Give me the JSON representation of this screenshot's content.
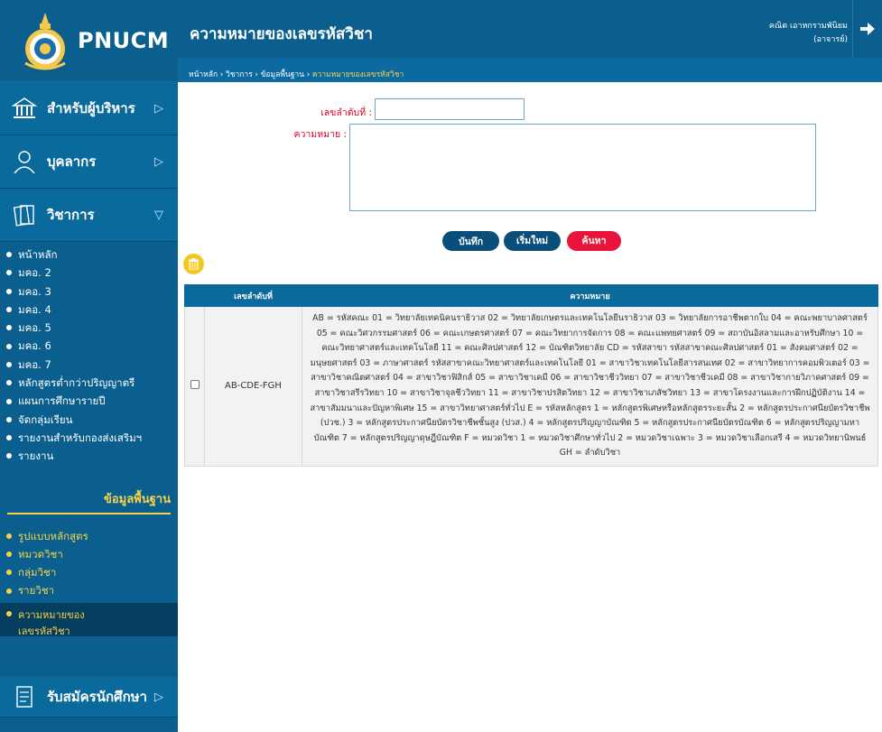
{
  "app": {
    "logo_text": "PNUCM"
  },
  "header": {
    "title": "ความหมายของเลขรหัสวิชา",
    "user_name": "คณิต เอาหกรามพันิยม",
    "user_role": "(อาจารย์)"
  },
  "breadcrumb": {
    "items": [
      "หน้าหลัก",
      "วิชาการ",
      "ข้อมูลพื้นฐาน"
    ],
    "separator": "›",
    "current": "ความหมายของเลขรหัสวิชา"
  },
  "sidebar": {
    "sections": [
      {
        "label": "สำหรับผู้บริหาร",
        "arrow": "▷"
      },
      {
        "label": "บุคลากร",
        "arrow": "▷"
      },
      {
        "label": "วิชาการ",
        "arrow": "▽"
      }
    ],
    "academic_items": [
      "หน้าหลัก",
      "มคอ. 2",
      "มคอ. 3",
      "มคอ. 4",
      "มคอ. 5",
      "มคอ. 6",
      "มคอ. 7",
      "หลักสูตรต่ำกว่าปริญญาตรี",
      "แผนการศึกษารายปี",
      "จัดกลุ่มเรียน",
      "รายงานสำหรับกองส่งเสริมฯ",
      "รายงาน"
    ],
    "data_title": "ข้อมูลพื้นฐาน",
    "data_items": [
      "รูปแบบหลักสูตร",
      "หมวดวิชา",
      "กลุ่มวิชา",
      "รายวิชา"
    ],
    "active_item_line1": "ความหมายของ",
    "active_item_line2": "เลขรหัสวิชา",
    "register_label": "รับสมัครนักศึกษา",
    "register_arrow": "▷"
  },
  "form": {
    "id_label": "เลขลำดับที่ :",
    "id_value": "",
    "meaning_label": "ความหมาย :",
    "meaning_value": "",
    "save_label": "บันทึก",
    "reset_label": "เริ่มใหม่",
    "search_label": "ค้นหา"
  },
  "table": {
    "columns": [
      "",
      "เลขลำดับที่",
      "ความหมาย"
    ],
    "rows": [
      {
        "code": "AB-CDE-FGH",
        "meaning": "AB = รหัสคณะ 01 = วิทยาลัยเทคนิคนราธิวาส 02 = วิทยาลัยเกษตรและเทคโนโลยีนราธิวาส 03 = วิทยาลัยการอาชีพตากใบ 04 = คณะพยาบาลศาสตร์ 05 = คณะวิศวกรรมศาสตร์ 06 = คณะเกษตรศาสตร์ 07 = คณะวิทยาการจัดการ 08 = คณะแพทยศาสตร์ 09 = สถาบันอิสลามและอาหรับศึกษา 10 = คณะวิทยาศาสตร์และเทคโนโลยี 11 = คณะศิลปศาสตร์ 12 = บัณฑิตวิทยาลัย CD = รหัสสาขา รหัสสาขาคณะศิลปศาสตร์ 01 = สังคมศาสตร์ 02 = มนุษยศาสตร์ 03 = ภาษาศาสตร์ รหัสสาขาคณะวิทยาศาสตร์และเทคโนโลยี 01 = สาขาวิชาเทคโนโลยีสารสนเทศ 02 = สาขาวิทยาการคอมพิวเตอร์ 03 = สาขาวิชาคณิตศาสตร์ 04 = สาขาวิชาฟิสิกส์ 05 = สาขาวิชาเคมี 06 = สาขาวิชาชีววิทยา 07 = สาขาวิชาชีวเคมี 08 = สาขาวิชากายวิภาคศาสตร์ 09 = สาขาวิชาสรีรวิทยา 10 = สาขาวิชาจุลชีววิทยา 11 = สาขาวิชาปรสิตวิทยา 12 = สาขาวิชาเภสัชวิทยา 13 = สาขาโครงงานและการฝึกปฏิบัติงาน 14 = สาขาสัมมนาและปัญหาพิเศษ 15 = สาขาวิทยาศาสตร์ทั่วไป E = รหัสหลักสูตร 1 = หลักสูตรพิเศษหรือหลักสูตรระยะสั้น 2 = หลักสูตรประกาศนียบัตรวิชาชีพ (ปวช.) 3 = หลักสูตรประกาศนียบัตรวิชาชีพชั้นสูง (ปวส.) 4 = หลักสูตรปริญญาบัณฑิต 5 = หลักสูตรประกาศนียบัตรบัณฑิต 6 = หลักสูตรปริญญามหาบัณฑิต 7 = หลักสูตรปริญญาดุษฎีบัณฑิต F = หมวดวิชา 1 = หมวดวิชาศึกษาทั่วไป 2 = หมวดวิชาเฉพาะ 3 = หมวดวิชาเลือกเสรี 4 = หมวดวิทยานิพนธ์ GH = ลำดับวิชา"
      }
    ]
  },
  "colors": {
    "primary": "#0a5f8f",
    "accent_yellow": "#f5d24a",
    "search_red": "#e8143c",
    "label_red": "#e0002a"
  },
  "icons": [
    "emblem-logo",
    "bank-icon",
    "person-icon",
    "books-icon",
    "register-icon",
    "logout-icon",
    "trash-icon"
  ]
}
